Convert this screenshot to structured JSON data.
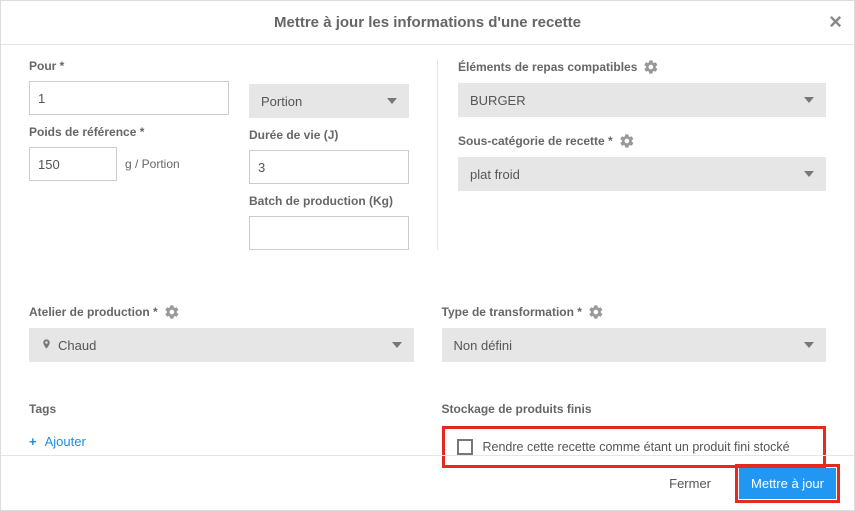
{
  "header": {
    "title": "Mettre à jour les informations d'une recette"
  },
  "pour": {
    "label": "Pour *",
    "value": "1",
    "unit_select": "Portion"
  },
  "poids_ref": {
    "label": "Poids de référence *",
    "value": "150",
    "unit": "g /  Portion"
  },
  "duree_vie": {
    "label": "Durée de vie (J)",
    "value": "3"
  },
  "batch": {
    "label": "Batch de production (Kg)",
    "value": ""
  },
  "elements": {
    "label": "Éléments de repas compatibles",
    "value": "BURGER"
  },
  "sous_cat": {
    "label": "Sous-catégorie de recette *",
    "value": "plat froid"
  },
  "atelier": {
    "label": "Atelier de production *",
    "value": "Chaud"
  },
  "transformation": {
    "label": "Type de transformation *",
    "value": "Non défini"
  },
  "tags": {
    "label": "Tags",
    "add": "Ajouter"
  },
  "storage": {
    "label": "Stockage de produits finis",
    "checkbox_label": "Rendre cette recette comme étant un produit fini stocké"
  },
  "footer": {
    "close": "Fermer",
    "submit": "Mettre à jour"
  }
}
